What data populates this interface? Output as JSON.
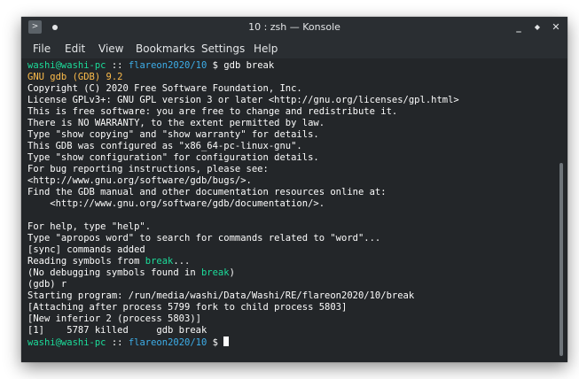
{
  "window": {
    "title": "10 : zsh — Konsole",
    "app_icon_glyph": ">",
    "buttons": {
      "minimize": "_",
      "maximize": "◆",
      "close": "✕"
    }
  },
  "menu": {
    "items": [
      "File",
      "Edit",
      "View",
      "Bookmarks",
      "Settings",
      "Help"
    ]
  },
  "colors": {
    "user_host": "#1cdc9a",
    "path": "#3daee9",
    "gdb_version": "#fdbc4b",
    "binary_name": "#1cdc9a"
  },
  "terminal": {
    "prompt1": {
      "user_host": "washi@washi-pc",
      "sep": " :: ",
      "path": "flareon2020/10",
      "symbol": " $ ",
      "command": "gdb break"
    },
    "gdb_version": "GNU gdb (GDB) 9.2",
    "banner": [
      "Copyright (C) 2020 Free Software Foundation, Inc.",
      "License GPLv3+: GNU GPL version 3 or later <http://gnu.org/licenses/gpl.html>",
      "This is free software: you are free to change and redistribute it.",
      "There is NO WARRANTY, to the extent permitted by law.",
      "Type \"show copying\" and \"show warranty\" for details.",
      "This GDB was configured as \"x86_64-pc-linux-gnu\".",
      "Type \"show configuration\" for configuration details.",
      "For bug reporting instructions, please see:",
      "<http://www.gnu.org/software/gdb/bugs/>.",
      "Find the GDB manual and other documentation resources online at:",
      "    <http://www.gnu.org/software/gdb/documentation/>.",
      "",
      "For help, type \"help\".",
      "Type \"apropos word\" to search for commands related to \"word\"...",
      "[sync] commands added"
    ],
    "reading_prefix": "Reading symbols from ",
    "reading_binary": "break",
    "reading_suffix": "...",
    "nodebug_prefix": "(No debugging symbols found in ",
    "nodebug_binary": "break",
    "nodebug_suffix": ")",
    "after": [
      "(gdb) r",
      "Starting program: /run/media/washi/Data/Washi/RE/flareon2020/10/break",
      "[Attaching after process 5799 fork to child process 5803]",
      "[New inferior 2 (process 5803)]",
      "[1]    5787 killed     gdb break"
    ],
    "prompt2": {
      "user_host": "washi@washi-pc",
      "sep": " :: ",
      "path": "flareon2020/10",
      "symbol": " $ "
    }
  }
}
